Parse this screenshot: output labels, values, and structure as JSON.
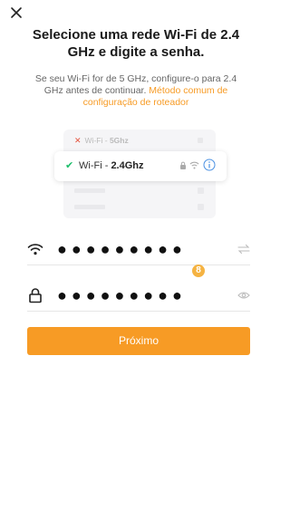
{
  "header": {
    "close_icon": "close-icon",
    "title": "Selecione uma rede Wi-Fi de 2.4 GHz e digite a senha."
  },
  "description": {
    "text": "Se seu Wi-Fi for de 5 GHz, configure-o para 2.4 GHz antes de continuar. ",
    "link_text": "Método comum de configuração de roteador"
  },
  "illustration": {
    "row_5g_prefix": "Wi-Fi - ",
    "row_5g_band": "5Ghz",
    "row_24g_prefix": "Wi-Fi - ",
    "row_24g_band": "2.4Ghz"
  },
  "form": {
    "wifi_password_masked": "●●●●●●●●●",
    "password_masked": "●●●●●●●●●",
    "badge_text": "8",
    "wifi_icon": "wifi-icon",
    "lock_icon": "lock-icon",
    "switch_icon": "switch-network-icon",
    "eye_icon": "eye-icon"
  },
  "actions": {
    "next_label": "Próximo"
  },
  "colors": {
    "accent": "#f79b25",
    "success": "#1cbf6b",
    "error": "#e5533d",
    "info": "#4a90e2"
  }
}
